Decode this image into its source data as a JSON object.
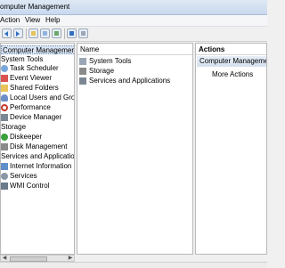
{
  "window": {
    "title": "omputer Management"
  },
  "menu": [
    "Action",
    "View",
    "Help"
  ],
  "toolbar": {
    "buttons": [
      {
        "name": "back-icon"
      },
      {
        "name": "forward-icon"
      },
      {
        "name": "up-folder-icon"
      },
      {
        "name": "show-hide-tree-icon"
      },
      {
        "name": "export-list-icon"
      },
      {
        "name": "help-icon"
      },
      {
        "name": "properties-icon"
      }
    ]
  },
  "tree": {
    "root": "Computer Management (Local)",
    "items": [
      {
        "label": "System Tools",
        "icon": "tools-icon",
        "level": 0
      },
      {
        "label": "Task Scheduler",
        "icon": "clock-icon",
        "level": 1
      },
      {
        "label": "Event Viewer",
        "icon": "event-viewer-icon",
        "level": 1
      },
      {
        "label": "Shared Folders",
        "icon": "folder-icon",
        "level": 1
      },
      {
        "label": "Local Users and Groups",
        "icon": "users-icon",
        "level": 1
      },
      {
        "label": "Performance",
        "icon": "performance-icon",
        "level": 1
      },
      {
        "label": "Device Manager",
        "icon": "device-icon",
        "level": 1
      },
      {
        "label": "Storage",
        "icon": "storage-icon",
        "level": 0
      },
      {
        "label": "Diskeeper",
        "icon": "diskeeper-icon",
        "level": 1
      },
      {
        "label": "Disk Management",
        "icon": "disk-icon",
        "level": 1
      },
      {
        "label": "Services and Applications",
        "icon": "services-icon",
        "level": 0
      },
      {
        "label": "Internet Information Services",
        "icon": "iis-icon",
        "level": 1
      },
      {
        "label": "Services",
        "icon": "gear-icon",
        "level": 1
      },
      {
        "label": "WMI Control",
        "icon": "wmi-icon",
        "level": 1
      }
    ]
  },
  "list": {
    "header": "Name",
    "rows": [
      {
        "label": "System Tools",
        "icon": "tools-icon"
      },
      {
        "label": "Storage",
        "icon": "storage-icon"
      },
      {
        "label": "Services and Applications",
        "icon": "services-icon"
      }
    ]
  },
  "actions": {
    "header": "Actions",
    "group": "Computer Management",
    "more": "More Actions"
  },
  "colors": {
    "selection": "#d9e4f3",
    "accent": "#3a78c6"
  }
}
